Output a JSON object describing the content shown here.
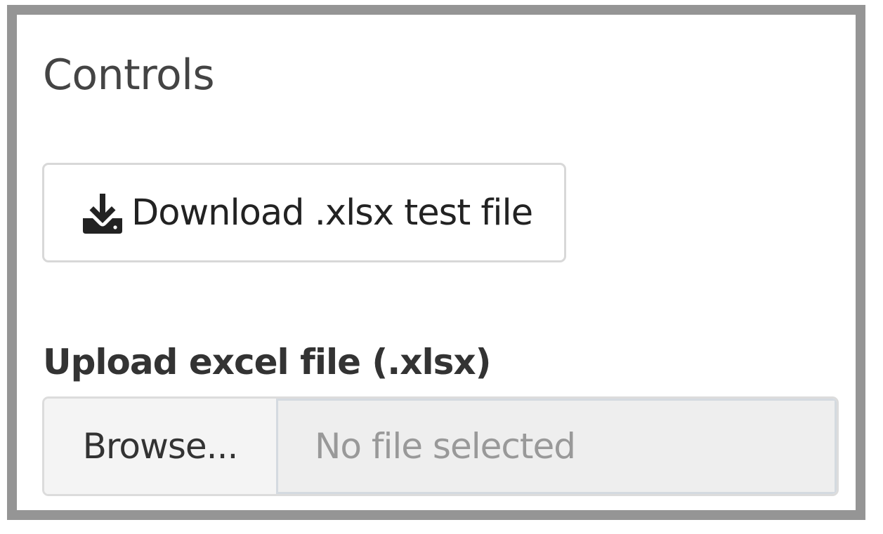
{
  "panel": {
    "title": "Controls"
  },
  "download": {
    "label": "Download .xlsx test file",
    "icon": "download-icon"
  },
  "upload": {
    "label": "Upload excel file (.xlsx)",
    "browse_label": "Browse...",
    "placeholder": "No file selected"
  }
}
